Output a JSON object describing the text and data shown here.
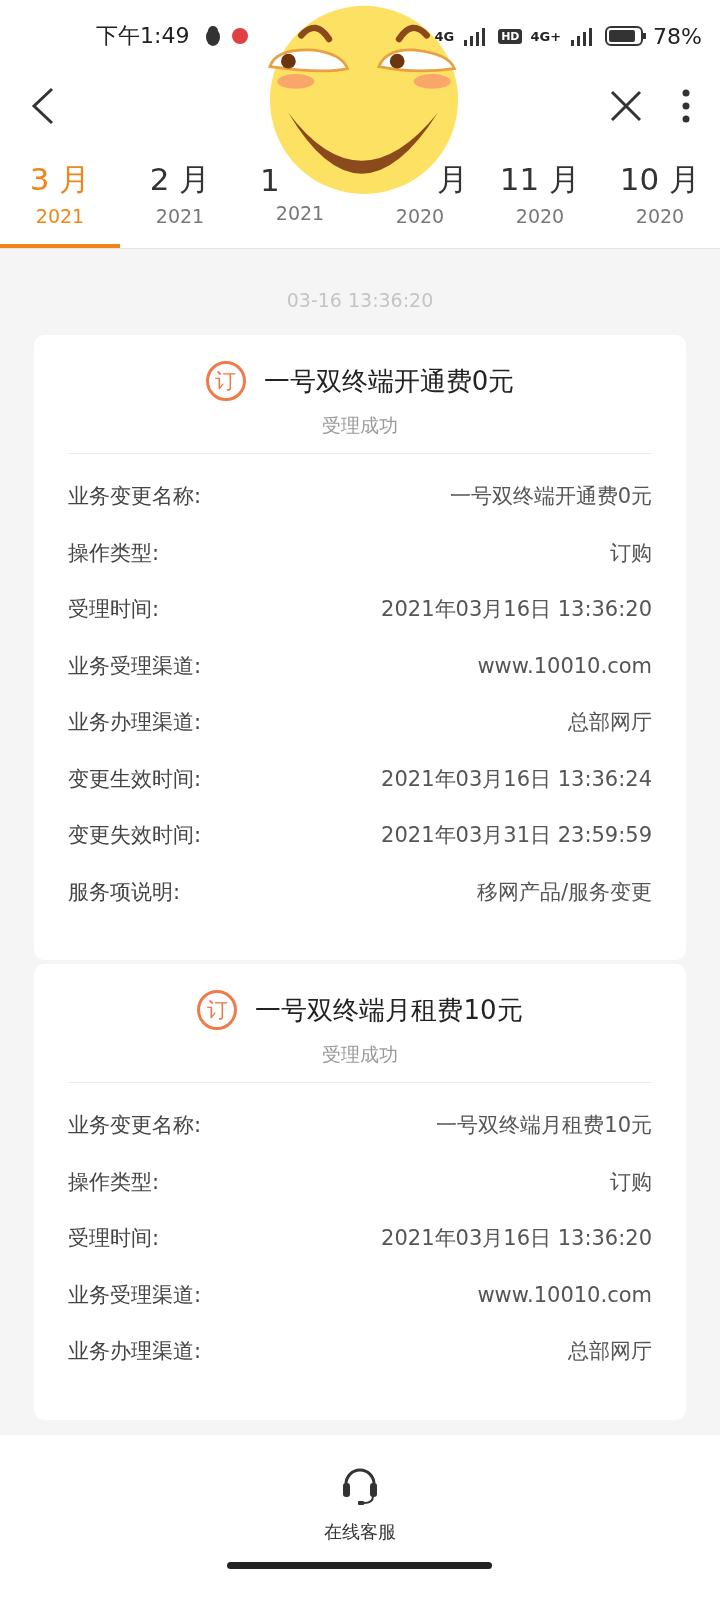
{
  "status_bar": {
    "time": "下午1:49",
    "net1": "4G",
    "hd": "HD",
    "net2": "4G+",
    "battery": "78%"
  },
  "tabs": [
    {
      "month": "3 月",
      "year": "2021",
      "selected": true
    },
    {
      "month": "2 月",
      "year": "2021",
      "selected": false
    },
    {
      "month": "1",
      "year": "2021",
      "selected": false
    },
    {
      "month": "月",
      "year": "2020",
      "selected": false
    },
    {
      "month": "11 月",
      "year": "2020",
      "selected": false
    },
    {
      "month": "10 月",
      "year": "2020",
      "selected": false
    }
  ],
  "timestamp": "03-16 13:36:20",
  "records": [
    {
      "badge": "订",
      "title": "一号双终端开通费0元",
      "status": "受理成功",
      "fields": [
        {
          "label": "业务变更名称:",
          "value": "一号双终端开通费0元"
        },
        {
          "label": "操作类型:",
          "value": "订购"
        },
        {
          "label": "受理时间:",
          "value": "2021年03月16日 13:36:20"
        },
        {
          "label": "业务受理渠道:",
          "value": "www.10010.com"
        },
        {
          "label": "业务办理渠道:",
          "value": "总部网厅"
        },
        {
          "label": "变更生效时间:",
          "value": "2021年03月16日 13:36:24"
        },
        {
          "label": "变更失效时间:",
          "value": "2021年03月31日 23:59:59"
        },
        {
          "label": "服务项说明:",
          "value": "移网产品/服务变更"
        }
      ]
    },
    {
      "badge": "订",
      "title": "一号双终端月租费10元",
      "status": "受理成功",
      "fields": [
        {
          "label": "业务变更名称:",
          "value": "一号双终端月租费10元"
        },
        {
          "label": "操作类型:",
          "value": "订购"
        },
        {
          "label": "受理时间:",
          "value": "2021年03月16日 13:36:20"
        },
        {
          "label": "业务受理渠道:",
          "value": "www.10010.com"
        },
        {
          "label": "业务办理渠道:",
          "value": "总部网厅"
        }
      ]
    }
  ],
  "bottom_action": {
    "label": "在线客服"
  }
}
